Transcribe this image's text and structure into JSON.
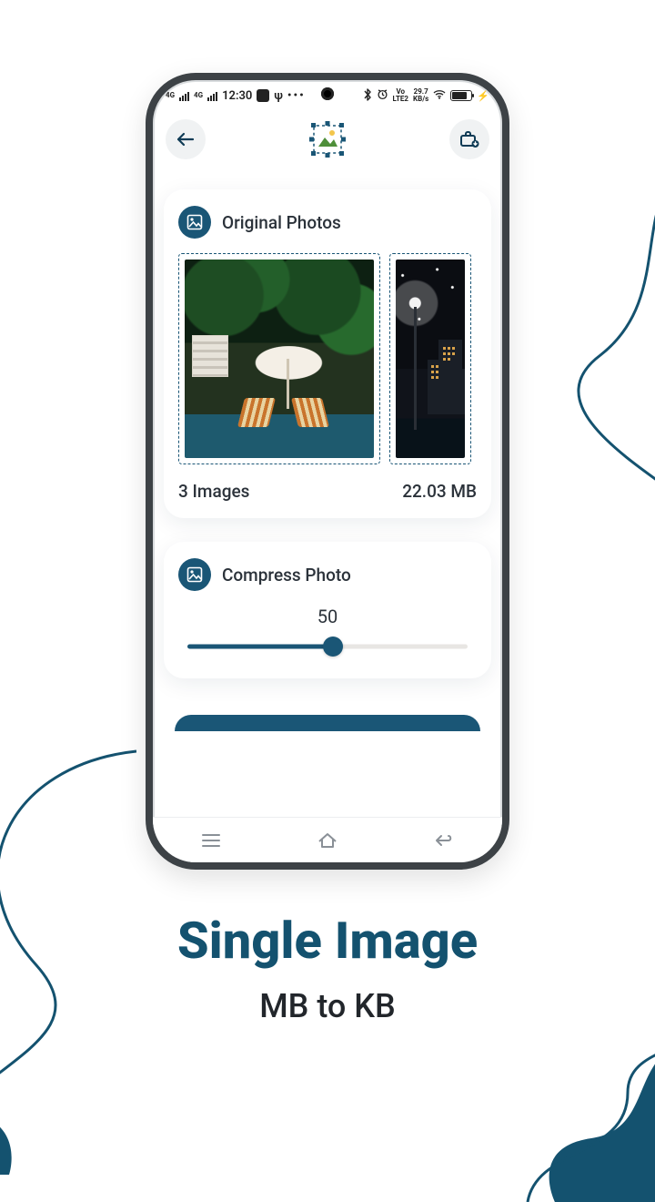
{
  "status": {
    "time": "12:30",
    "net_label": "4G",
    "lte_label": "LTE2",
    "vo_label": "Vo",
    "speed": "29.7",
    "speed_unit": "KB/s"
  },
  "header": {},
  "originals": {
    "title": "Original Photos",
    "count_label": "3 Images",
    "size_label": "22.03 MB"
  },
  "compress": {
    "title": "Compress Photo",
    "value": "50",
    "percent": 52
  },
  "marketing": {
    "headline": "Single Image",
    "subhead": "MB to KB"
  },
  "colors": {
    "accent": "#1a5676",
    "ink": "#2b323a"
  }
}
